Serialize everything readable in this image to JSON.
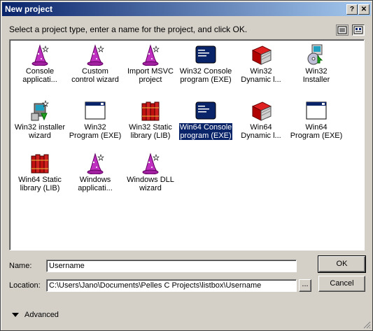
{
  "window": {
    "title": "New project",
    "help_btn": "?",
    "close_btn": "✕"
  },
  "instruction": "Select a project type, enter a name for the project, and click OK.",
  "view_buttons": [
    {
      "icon": "details-view-icon"
    },
    {
      "icon": "large-icons-view-icon"
    }
  ],
  "project_types": [
    {
      "line1": "Console",
      "line2": "applicati...",
      "icon": "wizard-hat-icon"
    },
    {
      "line1": "Custom",
      "line2": "control wizard",
      "icon": "wizard-hat-icon"
    },
    {
      "line1": "Import MSVC",
      "line2": "project",
      "icon": "wizard-hat-icon"
    },
    {
      "line1": "Win32 Console",
      "line2": "program (EXE)",
      "icon": "console-window-icon"
    },
    {
      "line1": "Win32",
      "line2": "Dynamic l...",
      "icon": "red-book-icon"
    },
    {
      "line1": "Win32",
      "line2": "Installer",
      "icon": "installer-icon"
    },
    {
      "line1": "Win32 installer",
      "line2": "wizard",
      "icon": "installer-wizard-icon"
    },
    {
      "line1": "Win32",
      "line2": "Program (EXE)",
      "icon": "window-icon"
    },
    {
      "line1": "Win32 Static",
      "line2": "library (LIB)",
      "icon": "books-icon"
    },
    {
      "line1": "Win64 Console",
      "line2": "program (EXE)",
      "icon": "console-window-icon",
      "selected": true
    },
    {
      "line1": "Win64",
      "line2": "Dynamic l...",
      "icon": "red-book-icon"
    },
    {
      "line1": "Win64",
      "line2": "Program (EXE)",
      "icon": "window-icon"
    },
    {
      "line1": "Win64 Static",
      "line2": "library (LIB)",
      "icon": "books-icon"
    },
    {
      "line1": "Windows",
      "line2": "applicati...",
      "icon": "wizard-hat-icon"
    },
    {
      "line1": "Windows DLL",
      "line2": "wizard",
      "icon": "wizard-hat-icon"
    }
  ],
  "form": {
    "name_label": "Name:",
    "name_value": "Username",
    "location_label": "Location:",
    "location_value": "C:\\Users\\Jano\\Documents\\Pelles C Projects\\listbox\\Username",
    "browse_label": "..."
  },
  "buttons": {
    "ok": "OK",
    "cancel": "Cancel"
  },
  "advanced_label": "Advanced",
  "colors": {
    "titlebar": "#0a246a",
    "selection": "#0a246a",
    "face": "#d4d0c8",
    "wizard_hat": "#c030c0"
  }
}
